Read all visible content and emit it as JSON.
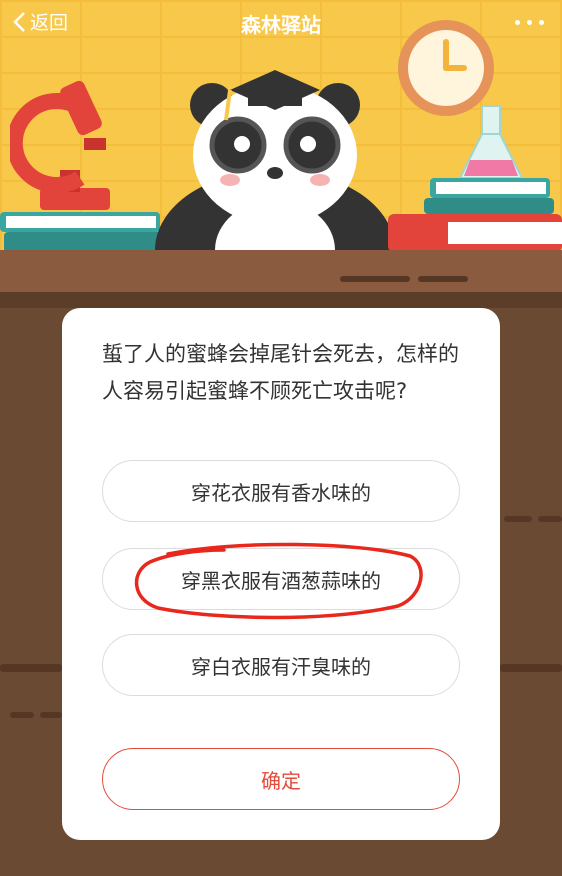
{
  "nav": {
    "back_label": "返回",
    "title": "森林驿站"
  },
  "quiz": {
    "question": "蜇了人的蜜蜂会掉尾针会死去，怎样的人容易引起蜜蜂不顾死亡攻击呢?",
    "options": [
      {
        "label": "穿花衣服有香水味的"
      },
      {
        "label": "穿黑衣服有酒葱蒜味的",
        "marked": true
      },
      {
        "label": "穿白衣服有汗臭味的"
      }
    ],
    "confirm_label": "确定"
  },
  "colors": {
    "scene_bg": "#f7c84a",
    "desk": "#8a5b3e",
    "background": "#6b4a34",
    "accent": "#e44b3c",
    "annotation": "#e8281c"
  }
}
